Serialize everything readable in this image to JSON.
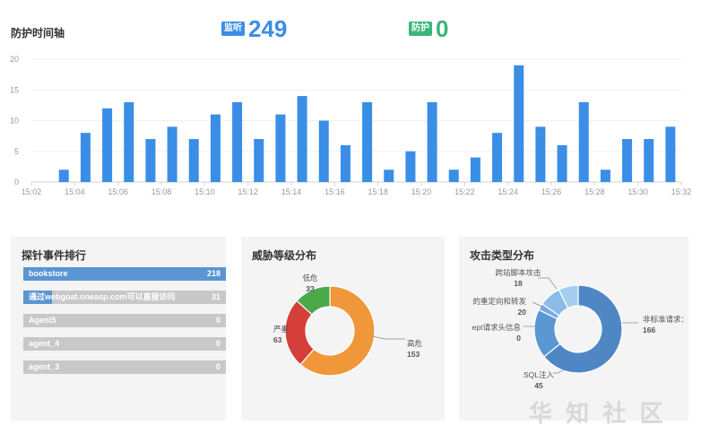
{
  "header": {
    "title": "防护时间轴",
    "listen": {
      "label": "监听",
      "value": "249",
      "color": "#3a8ee6"
    },
    "protect": {
      "label": "防护",
      "value": "0",
      "color": "#3bb57a"
    }
  },
  "chart_data": [
    {
      "type": "bar",
      "x": [
        "15:02",
        "15:03",
        "15:04",
        "15:05",
        "15:06",
        "15:07",
        "15:08",
        "15:09",
        "15:10",
        "15:11",
        "15:12",
        "15:13",
        "15:14",
        "15:15",
        "15:16",
        "15:17",
        "15:18",
        "15:19",
        "15:20",
        "15:21",
        "15:22",
        "15:23",
        "15:24",
        "15:25",
        "15:26",
        "15:27",
        "15:28",
        "15:29",
        "15:30",
        "15:31"
      ],
      "values": [
        0,
        2,
        8,
        12,
        13,
        7,
        9,
        7,
        11,
        13,
        7,
        11,
        14,
        10,
        6,
        13,
        2,
        5,
        13,
        2,
        4,
        8,
        19,
        9,
        6,
        13,
        2,
        7,
        7,
        9
      ],
      "xticks": [
        "15:02",
        "15:04",
        "15:06",
        "15:08",
        "15:10",
        "15:12",
        "15:14",
        "15:16",
        "15:18",
        "15:20",
        "15:22",
        "15:24",
        "15:26",
        "15:28",
        "15:30",
        "15:32"
      ],
      "yticks": [
        0,
        5,
        10,
        15,
        20
      ],
      "ylim": [
        0,
        20
      ],
      "bar_color": "#3a8ee6"
    },
    {
      "type": "pie",
      "title": "威胁等级分布",
      "slices": [
        {
          "label": "高危",
          "value": 153,
          "color": "#f0973a"
        },
        {
          "label": "严重",
          "value": 63,
          "color": "#d43f3a"
        },
        {
          "label": "低危",
          "value": 33,
          "color": "#4aaa4a"
        }
      ]
    },
    {
      "type": "pie",
      "title": "攻击类型分布",
      "slices": [
        {
          "label": "非标准请求：(",
          "value": 166,
          "color": "#4f87c4"
        },
        {
          "label": "SQL注入",
          "value": 45,
          "color": "#5b97d3"
        },
        {
          "label": "ept请求头信息",
          "value": 0,
          "color": "#74abe0"
        },
        {
          "label": "的重定向和转发",
          "value": 20,
          "color": "#8cbbe8"
        },
        {
          "label": "跨站脚本攻击",
          "value": 18,
          "color": "#a6cdf0"
        }
      ]
    }
  ],
  "ranking": {
    "title": "探针事件排行",
    "items": [
      {
        "name": "bookstore",
        "value": "218",
        "fill": 1.0
      },
      {
        "name": "通过webgoat.oneasp.com可以直接访问",
        "value": "31",
        "fill": 0.14
      },
      {
        "name": "Agent5",
        "value": "0",
        "fill": 0
      },
      {
        "name": "agent_4",
        "value": "0",
        "fill": 0
      },
      {
        "name": "agent_3",
        "value": "0",
        "fill": 0
      }
    ]
  },
  "threat": {
    "title": "威胁等级分布"
  },
  "attack": {
    "title": "攻击类型分布"
  },
  "watermark": "华 知 社 区"
}
